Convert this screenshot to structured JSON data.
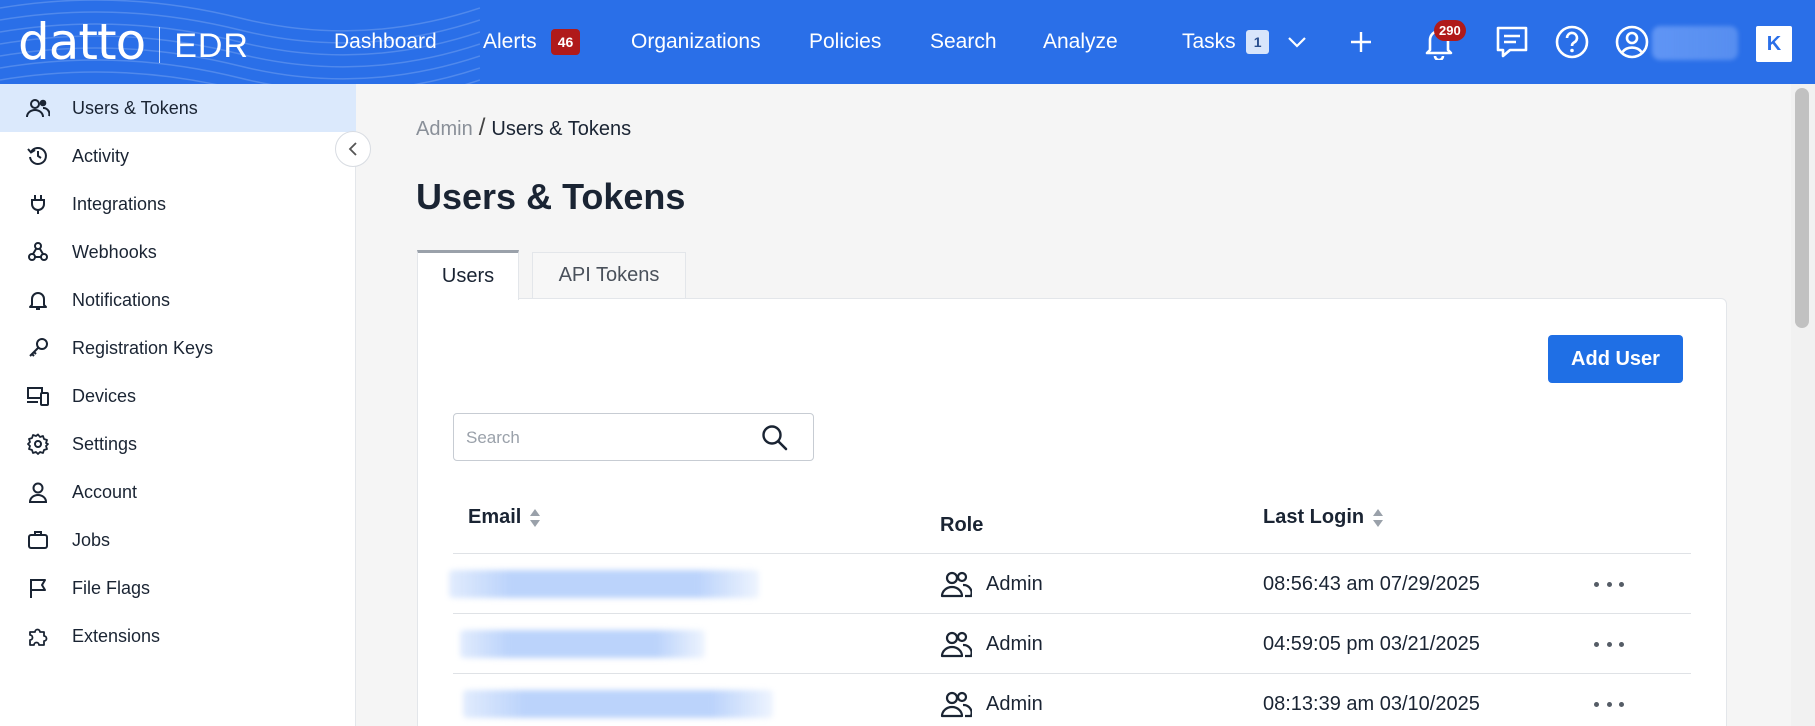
{
  "brand": {
    "logo_text": "datto",
    "product": "EDR"
  },
  "nav": {
    "dashboard": "Dashboard",
    "alerts": "Alerts",
    "alerts_count": "46",
    "organizations": "Organizations",
    "policies": "Policies",
    "search": "Search",
    "analyze": "Analyze",
    "tasks": "Tasks",
    "tasks_count": "1",
    "notifications_count": "290"
  },
  "sidebar": {
    "items": [
      {
        "label": "Users & Tokens",
        "icon": "users-icon",
        "active": true
      },
      {
        "label": "Activity",
        "icon": "history-icon"
      },
      {
        "label": "Integrations",
        "icon": "plug-icon"
      },
      {
        "label": "Webhooks",
        "icon": "webhook-icon"
      },
      {
        "label": "Notifications",
        "icon": "bell-icon"
      },
      {
        "label": "Registration Keys",
        "icon": "key-icon"
      },
      {
        "label": "Devices",
        "icon": "devices-icon"
      },
      {
        "label": "Settings",
        "icon": "gear-icon"
      },
      {
        "label": "Account",
        "icon": "person-icon"
      },
      {
        "label": "Jobs",
        "icon": "briefcase-icon"
      },
      {
        "label": "File Flags",
        "icon": "flag-icon"
      },
      {
        "label": "Extensions",
        "icon": "puzzle-icon"
      }
    ]
  },
  "breadcrumb": {
    "root": "Admin",
    "current": "Users & Tokens"
  },
  "page": {
    "title": "Users & Tokens"
  },
  "tabs": {
    "users": "Users",
    "api_tokens": "API Tokens"
  },
  "actions": {
    "add_user": "Add User"
  },
  "search": {
    "placeholder": "Search",
    "value": ""
  },
  "table": {
    "columns": {
      "email": "Email",
      "role": "Role",
      "last_login": "Last Login"
    },
    "rows": [
      {
        "email": "",
        "role": "Admin",
        "last_login": "08:56:43 am 07/29/2025"
      },
      {
        "email": "",
        "role": "Admin",
        "last_login": "04:59:05 pm 03/21/2025"
      },
      {
        "email": "",
        "role": "Admin",
        "last_login": "08:13:39 am 03/10/2025"
      }
    ]
  },
  "colors": {
    "topbar": "#2a6fe8",
    "primary_button": "#1f6fe5",
    "badge_red": "#b01a1a",
    "active_sidebar": "#dbe9fc"
  }
}
